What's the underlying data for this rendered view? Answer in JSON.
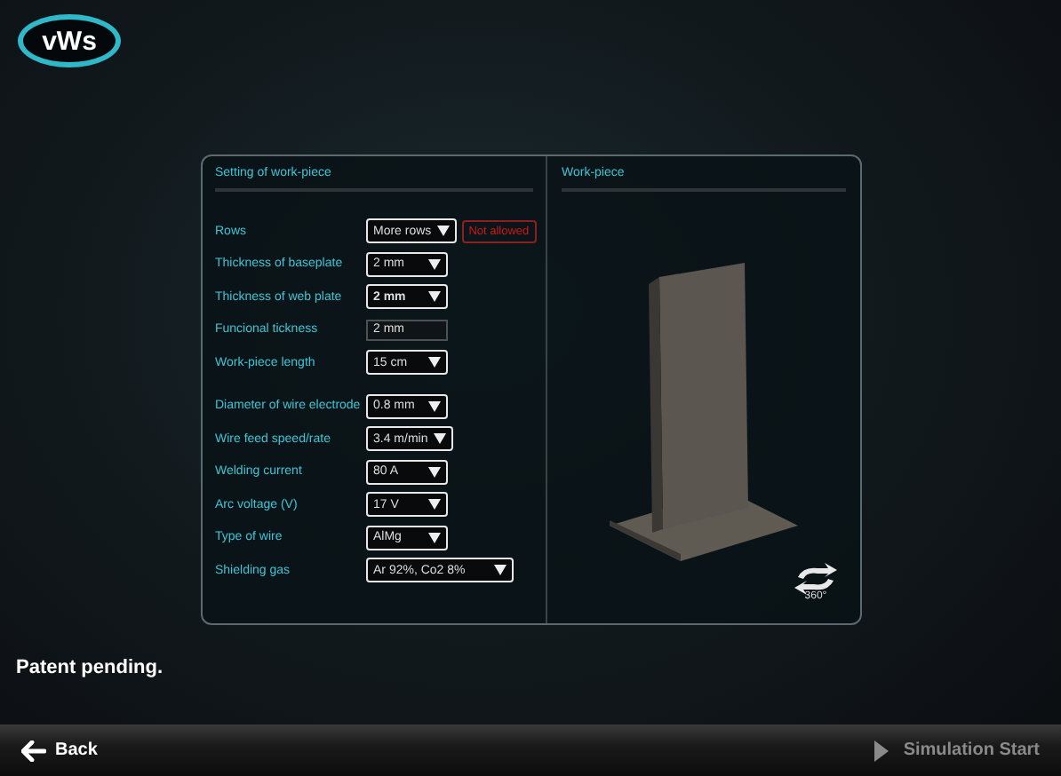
{
  "logo": {
    "text": "vWs"
  },
  "settings_panel": {
    "title": "Setting of work-piece",
    "groups": [
      {
        "fields": [
          {
            "label": "Rows",
            "kind": "dropdown",
            "value": "More rows",
            "emphasized": false,
            "warning": "Not allowed"
          },
          {
            "label": "Thickness of baseplate",
            "kind": "dropdown",
            "value": "2 mm",
            "emphasized": false
          },
          {
            "label": "Thickness of web plate",
            "kind": "dropdown",
            "value": "2 mm",
            "emphasized": true
          },
          {
            "label": "Funcional tickness",
            "kind": "text",
            "value": "2 mm",
            "emphasized": false
          },
          {
            "label": "Work-piece length",
            "kind": "dropdown",
            "value": "15 cm",
            "emphasized": false
          }
        ]
      },
      {
        "fields": [
          {
            "label": "Diameter of wire electrode",
            "kind": "dropdown",
            "value": "0.8 mm",
            "emphasized": false
          },
          {
            "label": "Wire feed speed/rate",
            "kind": "dropdown",
            "value": "3.4 m/min",
            "emphasized": false
          },
          {
            "label": "Welding current",
            "kind": "dropdown",
            "value": "80 A",
            "emphasized": false
          },
          {
            "label": "Arc voltage (V)",
            "kind": "dropdown",
            "value": "17 V",
            "emphasized": false
          },
          {
            "label": "Type of wire",
            "kind": "dropdown",
            "value": "AlMg",
            "emphasized": false
          },
          {
            "label": "Shielding gas",
            "kind": "wide-dropdown",
            "value": "Ar 92%, Co2 8%",
            "emphasized": false
          }
        ]
      }
    ]
  },
  "preview_panel": {
    "title": "Work-piece",
    "rotate_label": "360°"
  },
  "notice": "Patent pending.",
  "bottom_bar": {
    "back": {
      "label": "Back",
      "disabled": false
    },
    "start": {
      "label": "Simulation Start",
      "disabled": true
    }
  }
}
